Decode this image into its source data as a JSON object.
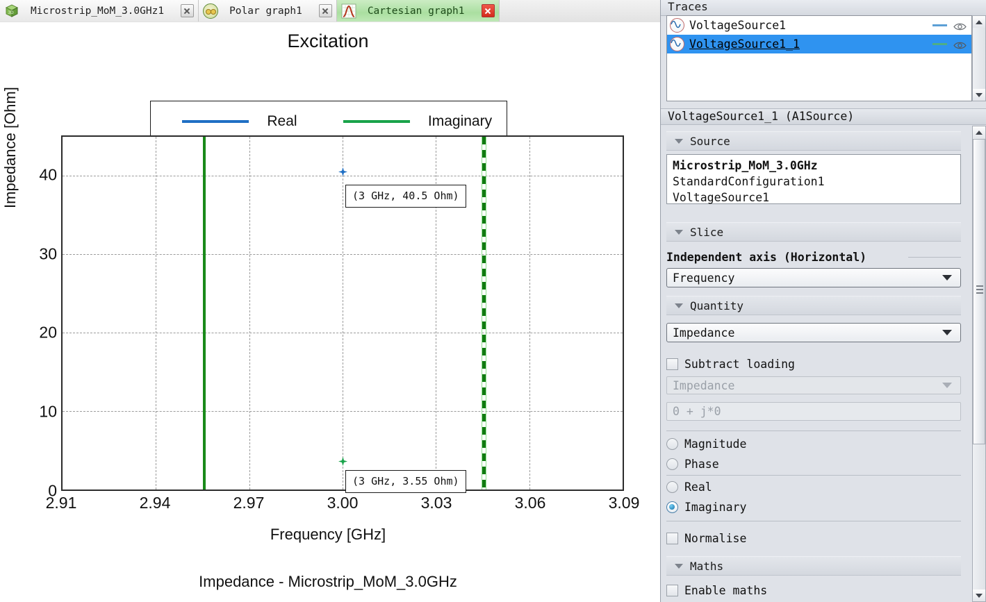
{
  "tabs": [
    {
      "label": "Microstrip_MoM_3.0GHz1",
      "icon": "cube-3d-icon",
      "active": false,
      "close_style": "grey"
    },
    {
      "label": "Polar graph1",
      "icon": "polar-graph-icon",
      "active": false,
      "close_style": "grey"
    },
    {
      "label": "Cartesian graph1",
      "icon": "cartesian-graph-icon",
      "active": true,
      "close_style": "red"
    }
  ],
  "chart_data": {
    "type": "scatter",
    "title": "Excitation",
    "xlabel": "Frequency [GHz]",
    "ylabel": "Impedance [Ohm]",
    "caption": "Impedance - Microstrip_MoM_3.0GHz",
    "xlim": [
      2.91,
      3.09
    ],
    "ylim": [
      0,
      45
    ],
    "xticks": [
      "2.91",
      "2.94",
      "2.97",
      "3.00",
      "3.03",
      "3.06",
      "3.09"
    ],
    "xtick_values": [
      2.91,
      2.94,
      2.97,
      3.0,
      3.03,
      3.06,
      3.09
    ],
    "yticks": [
      "0",
      "10",
      "20",
      "30",
      "40"
    ],
    "ytick_values": [
      0,
      10,
      20,
      30,
      40
    ],
    "grid": true,
    "legend_position": "above-plot",
    "legend": [
      {
        "label": "Real",
        "color": "#1f6fc4"
      },
      {
        "label": "Imaginary",
        "color": "#19a34a"
      }
    ],
    "series": [
      {
        "name": "Real",
        "color": "#1f6fc4",
        "x": [
          3.0
        ],
        "values": [
          40.5
        ],
        "marker": "star"
      },
      {
        "name": "Imaginary",
        "color": "#19a34a",
        "x": [
          3.0
        ],
        "values": [
          3.55
        ],
        "marker": "star"
      }
    ],
    "annotations": [
      {
        "text": "(3 GHz, 40.5 Ohm)",
        "x": 3.0,
        "y": 40.5
      },
      {
        "text": "(3 GHz,  3.55 Ohm)",
        "x": 3.0,
        "y": 3.55
      }
    ],
    "vertical_markers": [
      {
        "x": 2.955,
        "style": "solid",
        "color": "#1a8a1a"
      },
      {
        "x": 3.045,
        "style": "dashed",
        "color": "#117a11"
      }
    ]
  },
  "panel": {
    "traces_header": "Traces",
    "traces": [
      {
        "label": "VoltageSource1",
        "color": "#5c9fd6",
        "selected": false,
        "icon": "waveform-source-icon",
        "visibility_icon": "eye-icon"
      },
      {
        "label": "VoltageSource1_1",
        "color": "#4fae84",
        "selected": true,
        "icon": "waveform-source-icon",
        "visibility_icon": "eye-icon"
      }
    ],
    "selected_title": "VoltageSource1_1 (A1Source)",
    "section_source": "Source",
    "source_lines": [
      "Microstrip_MoM_3.0GHz",
      "StandardConfiguration1",
      "VoltageSource1"
    ],
    "section_slice": "Slice",
    "independent_axis_label": "Independent axis (Horizontal)",
    "independent_axis_value": "Frequency",
    "section_quantity": "Quantity",
    "quantity_value": "Impedance",
    "subtract_loading_label": "Subtract loading",
    "subtract_loading_checked": false,
    "subtract_loading_quantity": "Impedance",
    "subtract_loading_value": "0 + j*0",
    "component_options": [
      {
        "label": "Magnitude",
        "selected": false
      },
      {
        "label": "Phase",
        "selected": false
      },
      {
        "label": "Real",
        "selected": false
      },
      {
        "label": "Imaginary",
        "selected": true
      }
    ],
    "normalise_label": "Normalise",
    "normalise_checked": false,
    "section_maths": "Maths",
    "enable_maths_label": "Enable maths",
    "enable_maths_checked": false
  },
  "colors": {
    "real": "#1f6fc4",
    "imaginary": "#19a34a",
    "selection": "#2f93f0",
    "active_tab": "#aadfa0"
  }
}
